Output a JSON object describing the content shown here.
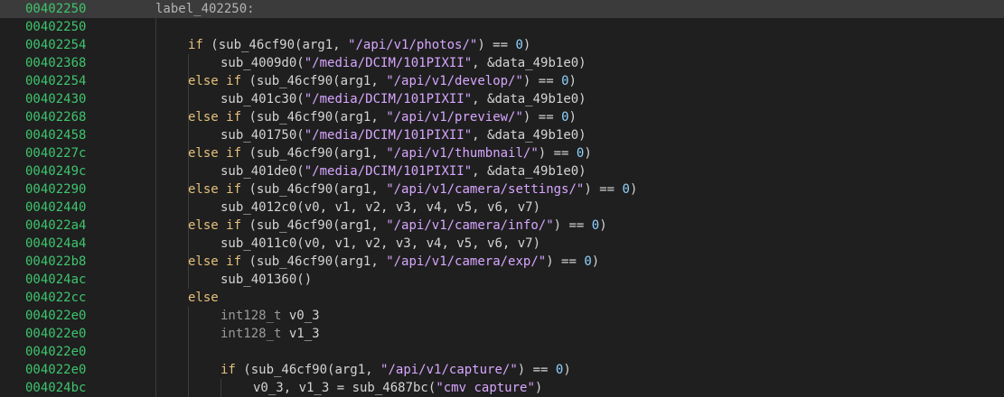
{
  "lines": [
    {
      "addr": "00402250",
      "indent": 0,
      "hl": true,
      "tokens": [
        {
          "t": "label_402250:",
          "c": "label"
        }
      ]
    },
    {
      "addr": "00402250",
      "indent": 0,
      "tokens": []
    },
    {
      "addr": "00402254",
      "indent": 1,
      "tokens": [
        {
          "t": "if",
          "c": "kw"
        },
        {
          "t": " (",
          "c": "op"
        },
        {
          "t": "sub_46cf90",
          "c": "fn"
        },
        {
          "t": "(arg1, ",
          "c": "op"
        },
        {
          "t": "\"/api/v1/photos/\"",
          "c": "str"
        },
        {
          "t": ") == ",
          "c": "op"
        },
        {
          "t": "0",
          "c": "num"
        },
        {
          "t": ")",
          "c": "op"
        }
      ]
    },
    {
      "addr": "00402368",
      "indent": 2,
      "tokens": [
        {
          "t": "sub_4009d0",
          "c": "fn"
        },
        {
          "t": "(",
          "c": "op"
        },
        {
          "t": "\"/media/DCIM/101PIXII\"",
          "c": "str"
        },
        {
          "t": ", &data_49b1e0)",
          "c": "op"
        }
      ]
    },
    {
      "addr": "00402254",
      "indent": 1,
      "tokens": [
        {
          "t": "else if",
          "c": "kw"
        },
        {
          "t": " (",
          "c": "op"
        },
        {
          "t": "sub_46cf90",
          "c": "fn"
        },
        {
          "t": "(arg1, ",
          "c": "op"
        },
        {
          "t": "\"/api/v1/develop/\"",
          "c": "str"
        },
        {
          "t": ") == ",
          "c": "op"
        },
        {
          "t": "0",
          "c": "num"
        },
        {
          "t": ")",
          "c": "op"
        }
      ]
    },
    {
      "addr": "00402430",
      "indent": 2,
      "tokens": [
        {
          "t": "sub_401c30",
          "c": "fn"
        },
        {
          "t": "(",
          "c": "op"
        },
        {
          "t": "\"/media/DCIM/101PIXII\"",
          "c": "str"
        },
        {
          "t": ", &data_49b1e0)",
          "c": "op"
        }
      ]
    },
    {
      "addr": "00402268",
      "indent": 1,
      "tokens": [
        {
          "t": "else if",
          "c": "kw"
        },
        {
          "t": " (",
          "c": "op"
        },
        {
          "t": "sub_46cf90",
          "c": "fn"
        },
        {
          "t": "(arg1, ",
          "c": "op"
        },
        {
          "t": "\"/api/v1/preview/\"",
          "c": "str"
        },
        {
          "t": ") == ",
          "c": "op"
        },
        {
          "t": "0",
          "c": "num"
        },
        {
          "t": ")",
          "c": "op"
        }
      ]
    },
    {
      "addr": "00402458",
      "indent": 2,
      "tokens": [
        {
          "t": "sub_401750",
          "c": "fn"
        },
        {
          "t": "(",
          "c": "op"
        },
        {
          "t": "\"/media/DCIM/101PIXII\"",
          "c": "str"
        },
        {
          "t": ", &data_49b1e0)",
          "c": "op"
        }
      ]
    },
    {
      "addr": "0040227c",
      "indent": 1,
      "tokens": [
        {
          "t": "else if",
          "c": "kw"
        },
        {
          "t": " (",
          "c": "op"
        },
        {
          "t": "sub_46cf90",
          "c": "fn"
        },
        {
          "t": "(arg1, ",
          "c": "op"
        },
        {
          "t": "\"/api/v1/thumbnail/\"",
          "c": "str"
        },
        {
          "t": ") == ",
          "c": "op"
        },
        {
          "t": "0",
          "c": "num"
        },
        {
          "t": ")",
          "c": "op"
        }
      ]
    },
    {
      "addr": "0040249c",
      "indent": 2,
      "tokens": [
        {
          "t": "sub_401de0",
          "c": "fn"
        },
        {
          "t": "(",
          "c": "op"
        },
        {
          "t": "\"/media/DCIM/101PIXII\"",
          "c": "str"
        },
        {
          "t": ", &data_49b1e0)",
          "c": "op"
        }
      ]
    },
    {
      "addr": "00402290",
      "indent": 1,
      "tokens": [
        {
          "t": "else if",
          "c": "kw"
        },
        {
          "t": " (",
          "c": "op"
        },
        {
          "t": "sub_46cf90",
          "c": "fn"
        },
        {
          "t": "(arg1, ",
          "c": "op"
        },
        {
          "t": "\"/api/v1/camera/settings/\"",
          "c": "str"
        },
        {
          "t": ") == ",
          "c": "op"
        },
        {
          "t": "0",
          "c": "num"
        },
        {
          "t": ")",
          "c": "op"
        }
      ]
    },
    {
      "addr": "00402440",
      "indent": 2,
      "tokens": [
        {
          "t": "sub_4012c0",
          "c": "fn"
        },
        {
          "t": "(v0, v1, v2, v3, v4, v5, v6, v7)",
          "c": "op"
        }
      ]
    },
    {
      "addr": "004022a4",
      "indent": 1,
      "tokens": [
        {
          "t": "else if",
          "c": "kw"
        },
        {
          "t": " (",
          "c": "op"
        },
        {
          "t": "sub_46cf90",
          "c": "fn"
        },
        {
          "t": "(arg1, ",
          "c": "op"
        },
        {
          "t": "\"/api/v1/camera/info/\"",
          "c": "str"
        },
        {
          "t": ") == ",
          "c": "op"
        },
        {
          "t": "0",
          "c": "num"
        },
        {
          "t": ")",
          "c": "op"
        }
      ]
    },
    {
      "addr": "004024a4",
      "indent": 2,
      "tokens": [
        {
          "t": "sub_4011c0",
          "c": "fn"
        },
        {
          "t": "(v0, v1, v2, v3, v4, v5, v6, v7)",
          "c": "op"
        }
      ]
    },
    {
      "addr": "004022b8",
      "indent": 1,
      "tokens": [
        {
          "t": "else if",
          "c": "kw"
        },
        {
          "t": " (",
          "c": "op"
        },
        {
          "t": "sub_46cf90",
          "c": "fn"
        },
        {
          "t": "(arg1, ",
          "c": "op"
        },
        {
          "t": "\"/api/v1/camera/exp/\"",
          "c": "str"
        },
        {
          "t": ") == ",
          "c": "op"
        },
        {
          "t": "0",
          "c": "num"
        },
        {
          "t": ")",
          "c": "op"
        }
      ]
    },
    {
      "addr": "004024ac",
      "indent": 2,
      "tokens": [
        {
          "t": "sub_401360",
          "c": "fn"
        },
        {
          "t": "()",
          "c": "op"
        }
      ]
    },
    {
      "addr": "004022cc",
      "indent": 1,
      "tokens": [
        {
          "t": "else",
          "c": "kw"
        }
      ]
    },
    {
      "addr": "004022e0",
      "indent": 2,
      "tokens": [
        {
          "t": "int128_t",
          "c": "type"
        },
        {
          "t": " v0_3",
          "c": "var"
        }
      ]
    },
    {
      "addr": "004022e0",
      "indent": 2,
      "tokens": [
        {
          "t": "int128_t",
          "c": "type"
        },
        {
          "t": " v1_3",
          "c": "var"
        }
      ]
    },
    {
      "addr": "004022e0",
      "indent": 0,
      "tokens": []
    },
    {
      "addr": "004022e0",
      "indent": 2,
      "tokens": [
        {
          "t": "if",
          "c": "kw"
        },
        {
          "t": " (",
          "c": "op"
        },
        {
          "t": "sub_46cf90",
          "c": "fn"
        },
        {
          "t": "(arg1, ",
          "c": "op"
        },
        {
          "t": "\"/api/v1/capture/\"",
          "c": "str"
        },
        {
          "t": ") == ",
          "c": "op"
        },
        {
          "t": "0",
          "c": "num"
        },
        {
          "t": ")",
          "c": "op"
        }
      ]
    },
    {
      "addr": "004024bc",
      "indent": 3,
      "tokens": [
        {
          "t": "v0_3, v1_3 = ",
          "c": "var"
        },
        {
          "t": "sub_4687bc",
          "c": "fn"
        },
        {
          "t": "(",
          "c": "op"
        },
        {
          "t": "\"cmv capture\"",
          "c": "str"
        },
        {
          "t": ")",
          "c": "op"
        }
      ]
    }
  ],
  "colors": {
    "background": "#1f1f1f",
    "highlight": "#3b3b3b",
    "address": "#3ec46d",
    "keyword": "#e4c07a",
    "string": "#d7a6ff",
    "number": "#8fd3ff",
    "text": "#d4d4d4"
  }
}
